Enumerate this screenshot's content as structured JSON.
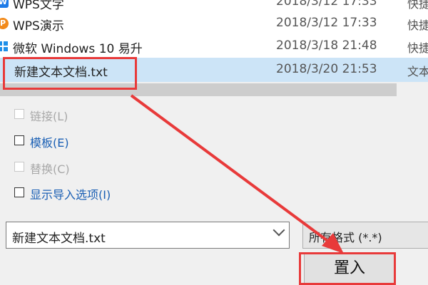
{
  "files": [
    {
      "name": "WPS文字",
      "date": "2018/3/12 17:33",
      "type": "快捷",
      "icon_color": "#1e7be8",
      "icon": "word-icon"
    },
    {
      "name": "WPS演示",
      "date": "2018/3/12 17:33",
      "type": "快捷",
      "icon_color": "#f28a1a",
      "icon": "presentation-icon"
    },
    {
      "name": "微软 Windows 10 易升",
      "date": "2018/3/18 21:48",
      "type": "快捷",
      "icon_color": "#1e8fe8",
      "icon": "windows-icon"
    },
    {
      "name": "新建文本文档.txt",
      "date": "2018/3/20 21:53",
      "type": "文本",
      "icon_color": "",
      "icon": ""
    }
  ],
  "options": [
    {
      "label": "链接(L)",
      "enabled": false
    },
    {
      "label": "模板(E)",
      "enabled": true
    },
    {
      "label": "替换(C)",
      "enabled": false
    },
    {
      "label": "显示导入选项(I)",
      "enabled": true
    }
  ],
  "filename_value": "新建文本文档.txt",
  "filetype_value": "所有格式 (*.*)",
  "insert_label": "置入",
  "colors": {
    "highlight": "#e83a3a",
    "selection": "#cce4f7"
  }
}
